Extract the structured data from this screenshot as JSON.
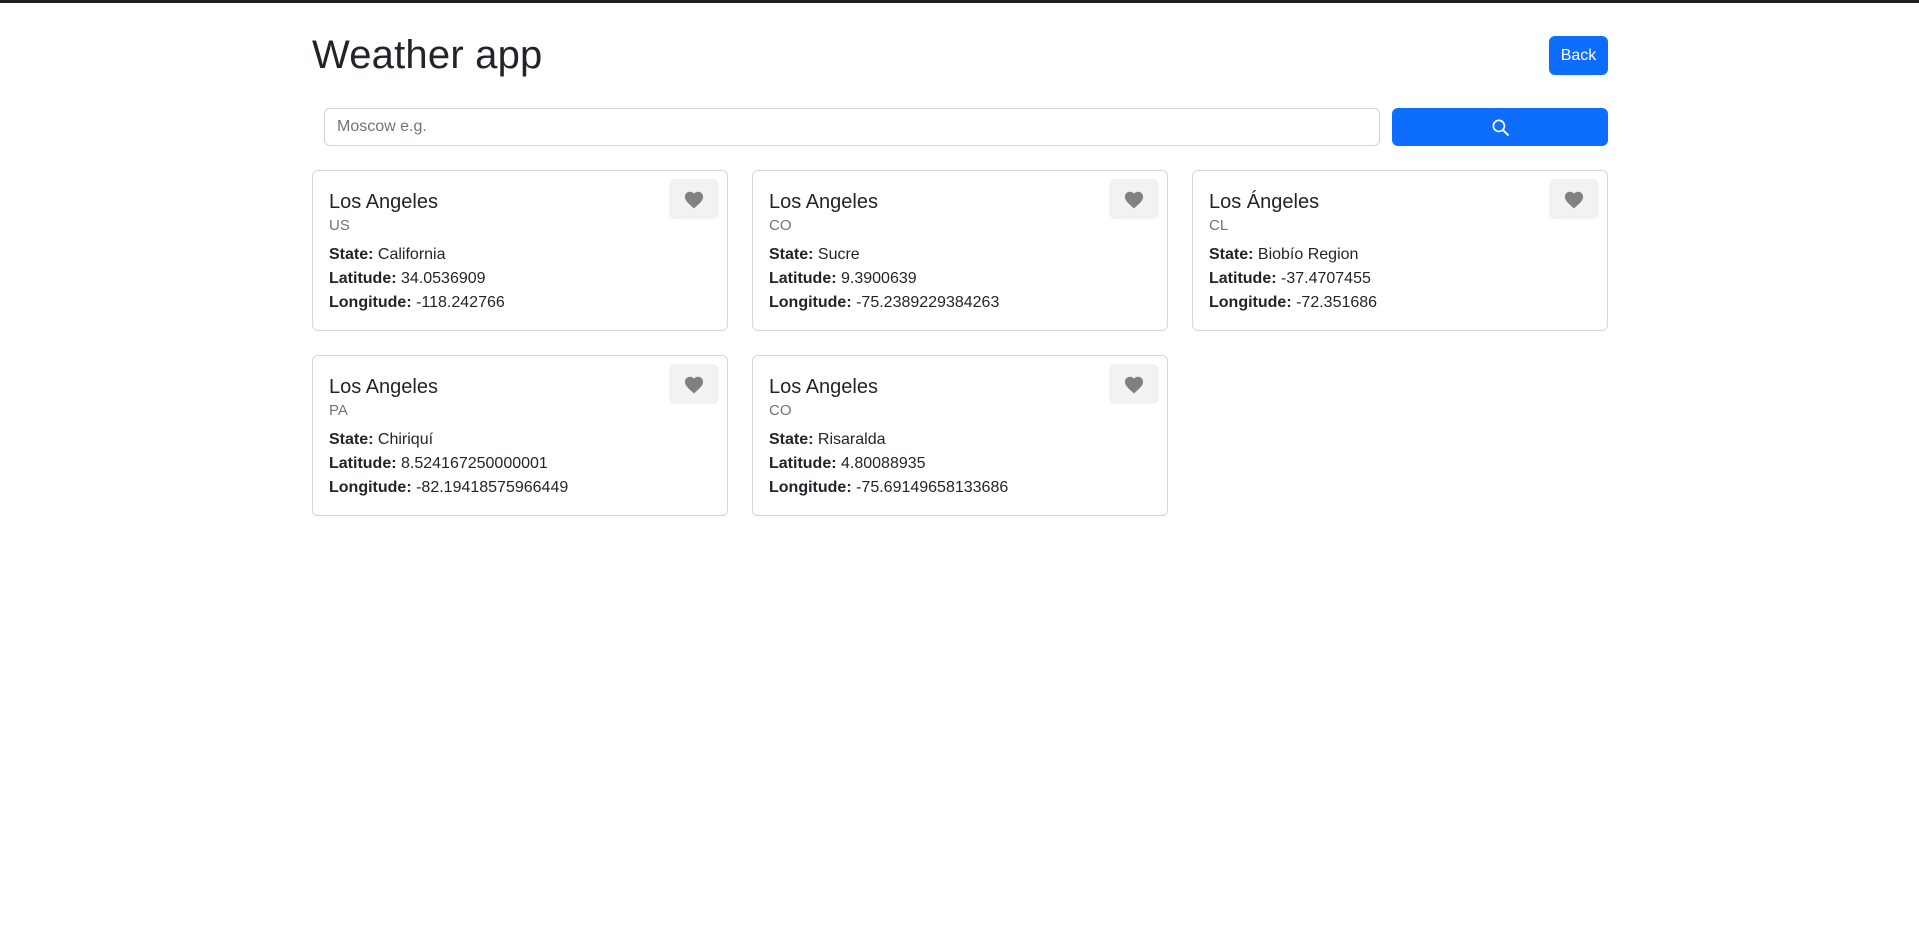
{
  "header": {
    "title": "Weather app",
    "back_label": "Back"
  },
  "search": {
    "placeholder": "Moscow e.g.",
    "button_icon": "search-icon"
  },
  "labels": {
    "state": "State:",
    "latitude": "Latitude:",
    "longitude": "Longitude:"
  },
  "cards": [
    {
      "city": "Los Angeles",
      "country": "US",
      "state": "California",
      "latitude": "34.0536909",
      "longitude": "-118.242766"
    },
    {
      "city": "Los Angeles",
      "country": "CO",
      "state": "Sucre",
      "latitude": "9.3900639",
      "longitude": "-75.2389229384263"
    },
    {
      "city": "Los Ángeles",
      "country": "CL",
      "state": "Biobío Region",
      "latitude": "-37.4707455",
      "longitude": "-72.351686"
    },
    {
      "city": "Los Angeles",
      "country": "PA",
      "state": "Chiriquí",
      "latitude": "8.524167250000001",
      "longitude": "-82.19418575966449"
    },
    {
      "city": "Los Angeles",
      "country": "CO",
      "state": "Risaralda",
      "latitude": "4.80088935",
      "longitude": "-75.69149658133686"
    }
  ],
  "colors": {
    "primary": "#0d6efd",
    "heart": "#808080",
    "fav_button_bg": "#f1f2f3"
  }
}
